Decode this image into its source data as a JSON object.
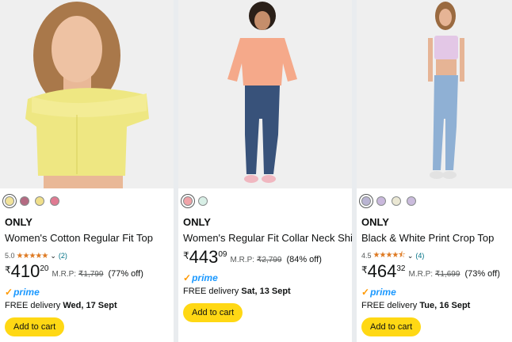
{
  "products": [
    {
      "image": "yellow off-shoulder ruffle top model",
      "swatch_colors": [
        "#f2e39a",
        "#b46a82",
        "#f0df8a",
        "#e07a92"
      ],
      "brand": "ONLY",
      "title": "Women's Cotton Regular Fit Top",
      "rating": "5.0",
      "stars": "★★★★★",
      "review_count": "(2)",
      "currency": "₹",
      "price_whole": "410",
      "price_fraction": "20",
      "mrp_label": "M.R.P:",
      "mrp": "₹1,799",
      "discount": "(77% off)",
      "prime": "prime",
      "delivery_prefix": "FREE delivery ",
      "delivery_date": "Wed, 17 Sept",
      "add_to_cart": "Add to cart"
    },
    {
      "image": "peach collar shirt and jeans model",
      "swatch_colors": [
        "#f0a3a8",
        "#d8efe6"
      ],
      "brand": "ONLY",
      "title": "Women's Regular Fit Collar Neck Shirt",
      "rating": "",
      "stars": "",
      "review_count": "",
      "currency": "₹",
      "price_whole": "443",
      "price_fraction": "09",
      "mrp_label": "M.R.P:",
      "mrp": "₹2,799",
      "discount": "(84% off)",
      "prime": "prime",
      "delivery_prefix": "FREE delivery ",
      "delivery_date": "Sat, 13 Sept",
      "add_to_cart": "Add to cart"
    },
    {
      "image": "lavender floral crop top and light jeans model",
      "swatch_colors": [
        "#b9b4d2",
        "#c9b8dc",
        "#ebe8d4",
        "#cabbdc"
      ],
      "brand": "ONLY",
      "title": "Black & White Print Crop Top",
      "rating": "4.5",
      "stars": "★★★★⯪",
      "review_count": "(4)",
      "currency": "₹",
      "price_whole": "464",
      "price_fraction": "32",
      "mrp_label": "M.R.P:",
      "mrp": "₹1,699",
      "discount": "(73% off)",
      "prime": "prime",
      "delivery_prefix": "FREE delivery ",
      "delivery_date": "Tue, 16 Sept",
      "add_to_cart": "Add to cart"
    }
  ],
  "colors": {
    "star": "#de7921",
    "prime": "#1a98ff",
    "cart_button": "#ffd814",
    "link": "#007185"
  }
}
